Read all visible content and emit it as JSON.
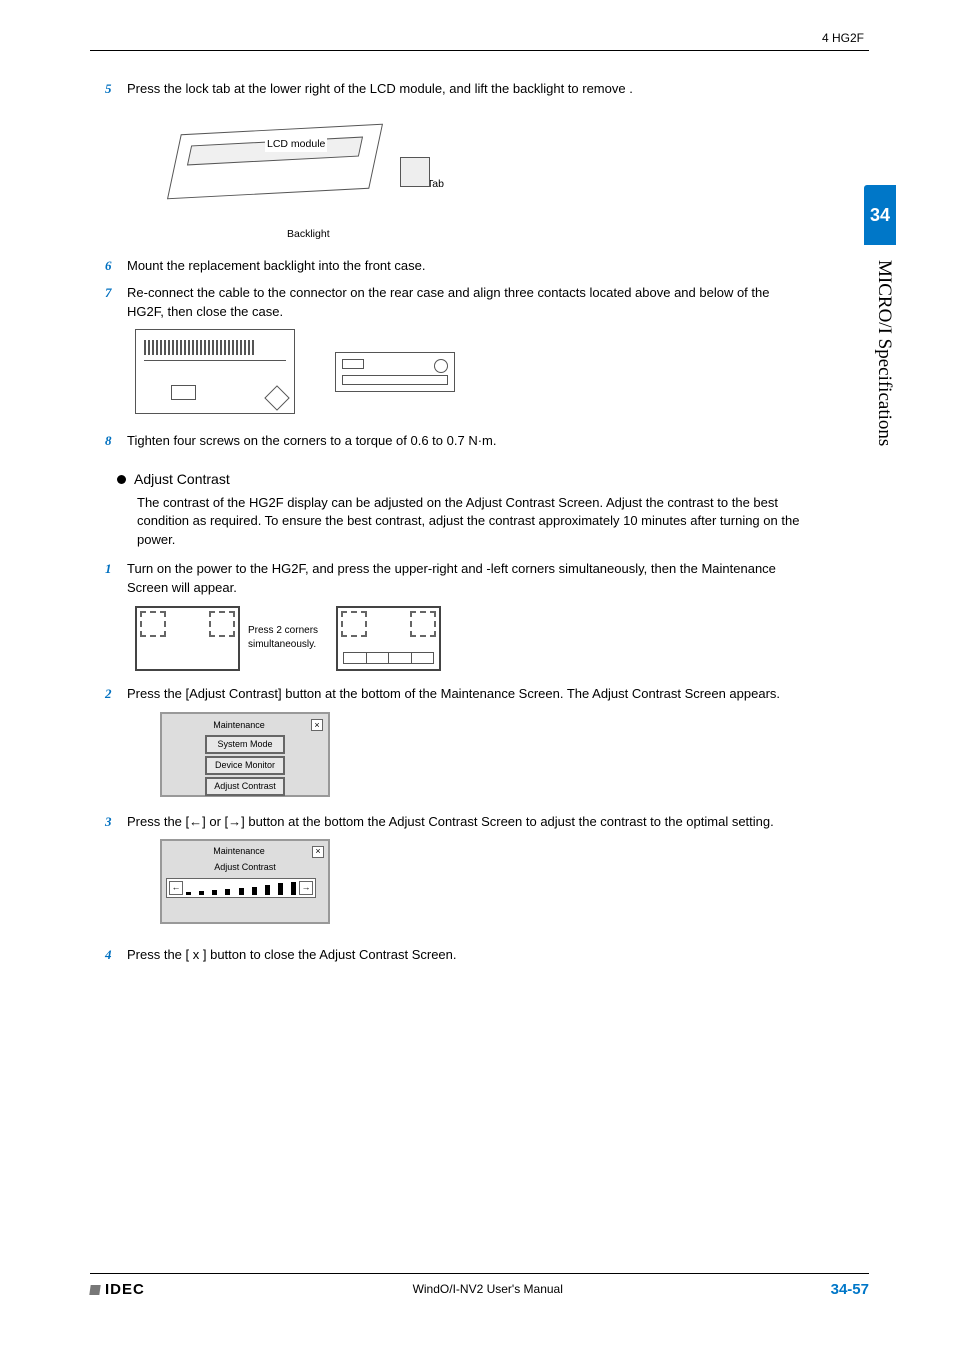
{
  "header": {
    "right": "4 HG2F"
  },
  "sideTab": {
    "num": "34",
    "title": "MICRO/I Specifications"
  },
  "steps": {
    "s5": {
      "num": "5",
      "text": "Press the lock tab at the lower right of the LCD module, and lift the backlight to remove ."
    },
    "s6": {
      "num": "6",
      "text": "Mount the replacement backlight into the front case."
    },
    "s7": {
      "num": "7",
      "text": "Re-connect the cable to the connector on the rear case and align three contacts located above and below of the HG2F, then close the case."
    },
    "s8": {
      "num": "8",
      "text": "Tighten four screws on the corners to a torque of 0.6 to 0.7 N·m."
    },
    "s1b": {
      "num": "1",
      "text": "Turn on the power to the HG2F, and press the upper-right and -left corners  simultaneously, then the Maintenance Screen will appear."
    },
    "s2b": {
      "num": "2",
      "text": "Press the [Adjust Contrast] button at the bottom of the Maintenance Screen. The Adjust Contrast Screen appears."
    },
    "s3b": {
      "num": "3",
      "text": "Press the [←] or [→] button at the bottom the Adjust Contrast Screen to adjust the contrast to the optimal setting."
    },
    "s4b": {
      "num": "4",
      "text": "Press the [ x ] button to close the Adjust Contrast Screen."
    }
  },
  "labels": {
    "lcd": "LCD module",
    "tab": "Tab",
    "backlight": "Backlight",
    "press2": "Press 2 corners simultaneously."
  },
  "adjust": {
    "heading": "Adjust Contrast",
    "desc": "The contrast of the HG2F display can be adjusted on the Adjust Contrast Screen. Adjust the contrast to the best condition as required. To ensure the best contrast, adjust the contrast approximately 10 minutes after turning on the power."
  },
  "maint": {
    "title": "Maintenance",
    "close": "×",
    "b1": "System Mode",
    "b2": "Device Monitor",
    "b3": "Adjust Contrast",
    "subtitle": "Adjust Contrast",
    "left": "←",
    "right": "→"
  },
  "footer": {
    "brand": "IDEC",
    "center": "WindO/I-NV2 User's Manual",
    "page": "34-57"
  }
}
